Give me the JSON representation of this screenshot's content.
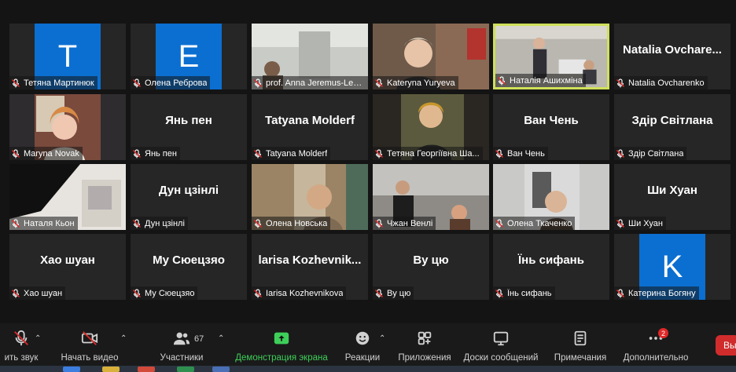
{
  "participants": [
    {
      "name": "Тетяна Мартинюк",
      "avatar": "T",
      "kind": "letter"
    },
    {
      "name": "Олена Реброва",
      "avatar": "E",
      "kind": "letter"
    },
    {
      "name": "prof. Anna Jeremus-Lewa...",
      "kind": "photo"
    },
    {
      "name": "Kateryna Yuryeva",
      "kind": "photo"
    },
    {
      "name": "Наталія Ашихміна",
      "kind": "photo",
      "active": true
    },
    {
      "name": "Natalia Ovcharenko",
      "display": "Natalia  Ovchare...",
      "kind": "text"
    },
    {
      "name": "Maryna Novak",
      "kind": "photo"
    },
    {
      "name": "Янь пен",
      "display": "Янь пен",
      "kind": "text"
    },
    {
      "name": "Tatyana Molderf",
      "display": "Tatyana Molderf",
      "kind": "text"
    },
    {
      "name": "Тетяна Георгіївна Ша...",
      "kind": "photo"
    },
    {
      "name": "Ван Чень",
      "display": "Ван Чень",
      "kind": "text"
    },
    {
      "name": "Здір Світлана",
      "display": "Здір Світлана",
      "kind": "text"
    },
    {
      "name": "Наталя Кьон",
      "kind": "photo"
    },
    {
      "name": "Дун цзінлі",
      "display": "Дун цзінлі",
      "kind": "text"
    },
    {
      "name": "Олена Новська",
      "kind": "photo"
    },
    {
      "name": "Чжан Венлі",
      "kind": "photo"
    },
    {
      "name": "Олена Ткаченко",
      "kind": "photo"
    },
    {
      "name": "Ши Хуан",
      "display": "Ши Хуан",
      "kind": "text"
    },
    {
      "name": "Хао шуан",
      "display": "Хао шуан",
      "kind": "text"
    },
    {
      "name": "Му Сюецзяо",
      "display": "Му Сюецзяо",
      "kind": "text"
    },
    {
      "name": "Iarisa Kozhevnikova",
      "display": "larisa  Kozhevnik...",
      "kind": "text"
    },
    {
      "name": "Ву цю",
      "display": "Ву цю",
      "kind": "text"
    },
    {
      "name": "Їнь сифань",
      "display": "Їнь сифань",
      "kind": "text"
    },
    {
      "name": "Катерина Богяну",
      "avatar": "K",
      "kind": "letter"
    }
  ],
  "toolbar": {
    "mute_label": "ить звук",
    "video_label": "Начать видео",
    "participants_label": "Участники",
    "participants_count": "67",
    "share_label": "Демонстрация экрана",
    "reactions_label": "Реакции",
    "apps_label": "Приложения",
    "whiteboards_label": "Доски сообщений",
    "notes_label": "Примечания",
    "more_label": "Дополнительно",
    "more_badge": "2",
    "end_label": "Вы"
  },
  "colors": {
    "accent_green": "#3ecf59",
    "avatar_blue": "#0b6fd1",
    "active_border": "#cfe05a",
    "alert_red": "#e02828"
  }
}
